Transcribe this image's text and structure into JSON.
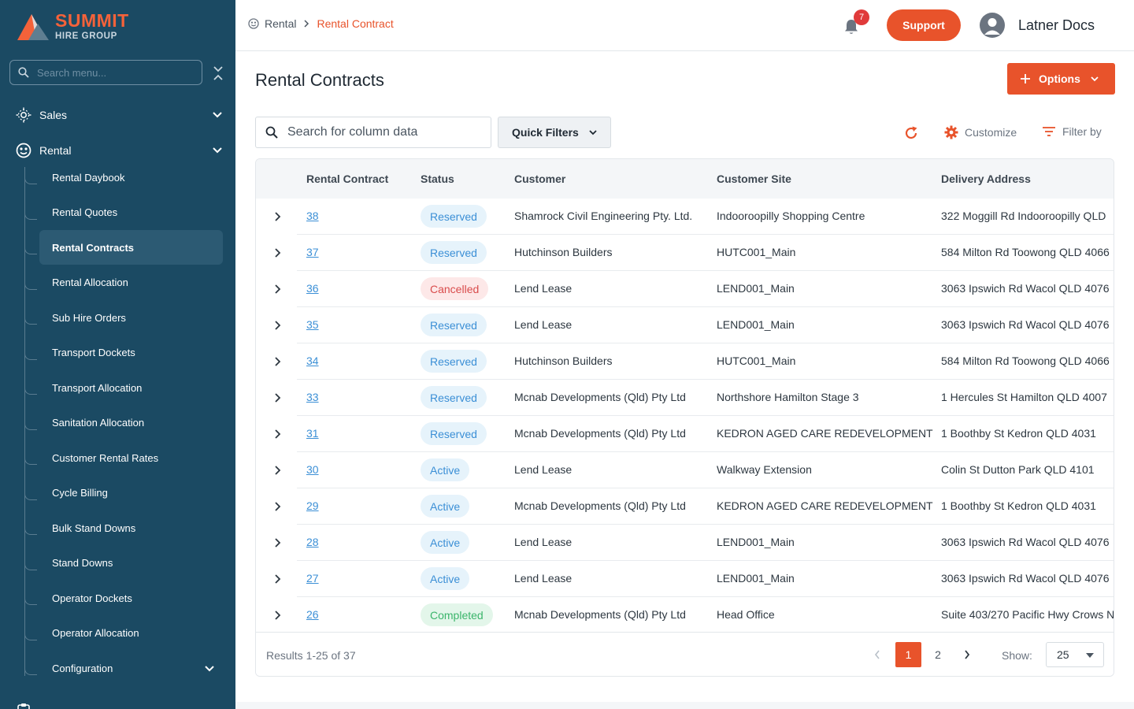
{
  "brand": {
    "name": "SUMMIT",
    "sub": "HIRE GROUP",
    "accent": "#e8532b",
    "sidebar_bg": "#1b4a63"
  },
  "sidebar": {
    "search_placeholder": "Search menu...",
    "sections": [
      {
        "label": "Sales",
        "icon": "sales-icon"
      },
      {
        "label": "Rental",
        "icon": "rental-icon"
      }
    ],
    "rental_items": [
      {
        "label": "Rental Daybook"
      },
      {
        "label": "Rental Quotes"
      },
      {
        "label": "Rental Contracts",
        "active": true
      },
      {
        "label": "Rental Allocation"
      },
      {
        "label": "Sub Hire Orders"
      },
      {
        "label": "Transport Dockets"
      },
      {
        "label": "Transport Allocation"
      },
      {
        "label": "Sanitation Allocation"
      },
      {
        "label": "Customer Rental Rates"
      },
      {
        "label": "Cycle Billing"
      },
      {
        "label": "Bulk Stand Downs"
      },
      {
        "label": "Stand Downs"
      },
      {
        "label": "Operator Dockets"
      },
      {
        "label": "Operator Allocation"
      },
      {
        "label": "Configuration"
      }
    ]
  },
  "header": {
    "breadcrumb": [
      "Rental",
      "Rental Contract"
    ],
    "notification_count": "7",
    "support_label": "Support",
    "user_name": "Latner Docs"
  },
  "main": {
    "title": "Rental Contracts",
    "options_label": "Options",
    "search_placeholder": "Search for column data",
    "quick_filters_label": "Quick Filters",
    "customize_label": "Customize",
    "filter_label": "Filter by"
  },
  "table": {
    "columns": [
      "Rental Contract",
      "Status",
      "Customer",
      "Customer Site",
      "Delivery Address"
    ],
    "rows": [
      {
        "id": "38",
        "status": "Reserved",
        "customer": "Shamrock Civil Engineering Pty. Ltd.",
        "site": "Indooroopilly Shopping Centre",
        "address": "322 Moggill Rd Indooroopilly QLD"
      },
      {
        "id": "37",
        "status": "Reserved",
        "customer": "Hutchinson Builders",
        "site": "HUTC001_Main",
        "address": "584 Milton Rd Toowong QLD 4066"
      },
      {
        "id": "36",
        "status": "Cancelled",
        "customer": "Lend Lease",
        "site": "LEND001_Main",
        "address": "3063 Ipswich Rd Wacol QLD 4076"
      },
      {
        "id": "35",
        "status": "Reserved",
        "customer": "Lend Lease",
        "site": "LEND001_Main",
        "address": "3063 Ipswich Rd Wacol QLD 4076"
      },
      {
        "id": "34",
        "status": "Reserved",
        "customer": "Hutchinson Builders",
        "site": "HUTC001_Main",
        "address": "584 Milton Rd Toowong QLD 4066"
      },
      {
        "id": "33",
        "status": "Reserved",
        "customer": "Mcnab Developments (Qld) Pty Ltd",
        "site": "Northshore Hamilton Stage 3",
        "address": "1 Hercules St Hamilton QLD 4007"
      },
      {
        "id": "31",
        "status": "Reserved",
        "customer": "Mcnab Developments (Qld) Pty Ltd",
        "site": "KEDRON AGED CARE REDEVELOPMENT",
        "address": "1 Boothby St Kedron QLD 4031"
      },
      {
        "id": "30",
        "status": "Active",
        "customer": "Lend Lease",
        "site": "Walkway Extension",
        "address": "Colin St Dutton Park QLD 4101"
      },
      {
        "id": "29",
        "status": "Active",
        "customer": "Mcnab Developments (Qld) Pty Ltd",
        "site": "KEDRON AGED CARE REDEVELOPMENT",
        "address": "1 Boothby St Kedron QLD 4031"
      },
      {
        "id": "28",
        "status": "Active",
        "customer": "Lend Lease",
        "site": "LEND001_Main",
        "address": "3063 Ipswich Rd Wacol QLD 4076"
      },
      {
        "id": "27",
        "status": "Active",
        "customer": "Lend Lease",
        "site": "LEND001_Main",
        "address": "3063 Ipswich Rd Wacol QLD 4076"
      },
      {
        "id": "26",
        "status": "Completed",
        "customer": "Mcnab Developments (Qld) Pty Ltd",
        "site": "Head Office",
        "address": "Suite 403/270 Pacific Hwy Crows N"
      }
    ]
  },
  "footer": {
    "results_text": "Results 1-25 of 37",
    "pages": [
      "1",
      "2"
    ],
    "show_label": "Show:",
    "page_size": "25"
  }
}
